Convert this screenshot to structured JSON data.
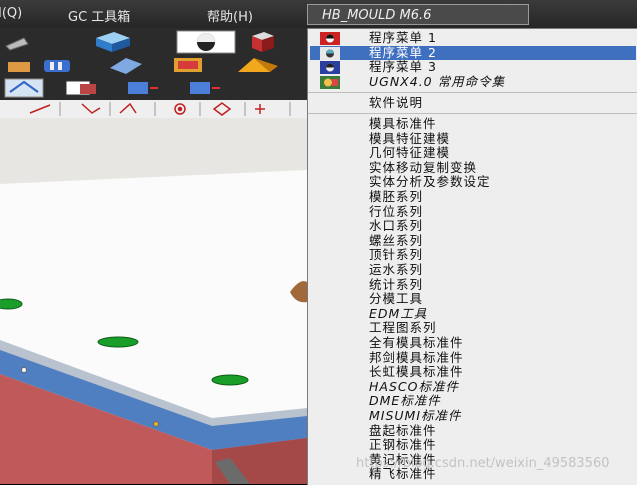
{
  "menubar": {
    "items": [
      "I(Q)",
      "GC 工具箱",
      "帮助(H)"
    ],
    "active_menu": "HB_MOULD M6.6"
  },
  "toolbar": {
    "icons": [
      "draw-icon",
      "box-icon",
      "render-style-icon",
      "color-box-icon",
      "cylinder-icon",
      "mold-icon",
      "move-icon",
      "plane-icon",
      "pyramid-icon",
      "snap-line-icon",
      "snap-curve-icon",
      "snap-point-icon",
      "snap-arc-icon",
      "snap-center-icon",
      "snap-quadrant-icon",
      "snap-cross-icon"
    ]
  },
  "menu": {
    "items": [
      {
        "label": "程序菜单 1",
        "italic_suffix": true,
        "icon": "program-menu-icon",
        "highlighted": false
      },
      {
        "label": "程序菜单 2",
        "italic_suffix": true,
        "icon": "program-menu-icon",
        "highlighted": true
      },
      {
        "label": "程序菜单 3",
        "italic_suffix": true,
        "icon": "program-menu-icon",
        "highlighted": false
      },
      {
        "label": "UGNX4.0 常用命令集",
        "italic_suffix": false,
        "icon": "ugnx-icon",
        "highlighted": false
      }
    ],
    "plain_items": [
      "软件说明",
      "模具标准件",
      "模具特征建模",
      "几何特征建模",
      "实体移动复制变换",
      "实体分析及参数设定",
      "模胚系列",
      "行位系列",
      "水口系列",
      "螺丝系列",
      "顶针系列",
      "运水系列",
      "统计系列",
      "分模工具",
      "EDM工具",
      "工程图系列",
      "全有模具标准件",
      "邦剑模具标准件",
      "长虹模具标准件",
      "HASCO标准件",
      "DME标准件",
      "MISUMI标准件",
      "盘起标准件",
      "正钢标准件",
      "黄记标准件",
      "精飞标准件"
    ]
  },
  "watermark": "https://blog.csdn.net/weixin_49583560",
  "colors": {
    "menu_bg": "#eeeeee",
    "highlight": "#3f6fbf",
    "menubar_bg": "#2e2e2e",
    "viewport_bg": "#e8e8e4"
  }
}
